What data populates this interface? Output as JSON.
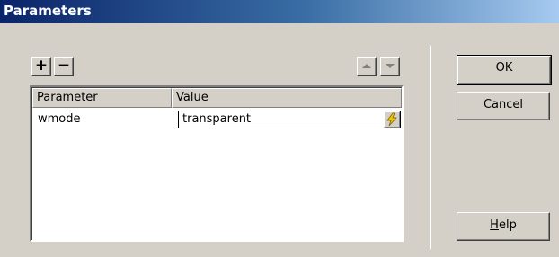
{
  "window": {
    "title": "Parameters"
  },
  "toolbar": {
    "add_label": "+",
    "remove_label": "−",
    "move_up_icon": "arrow-up-icon",
    "move_down_icon": "arrow-down-icon"
  },
  "table": {
    "columns": [
      "Parameter",
      "Value"
    ],
    "rows": [
      {
        "parameter": "wmode",
        "value": "transparent"
      }
    ],
    "value_button_icon": "lightning-icon"
  },
  "buttons": {
    "ok": "OK",
    "cancel": "Cancel",
    "help_mnemonic": "H",
    "help_rest": "elp"
  },
  "colors": {
    "title_start": "#0a246a",
    "title_end": "#a6caf0",
    "face": "#d4d0c8",
    "bolt": "#f0c800"
  }
}
